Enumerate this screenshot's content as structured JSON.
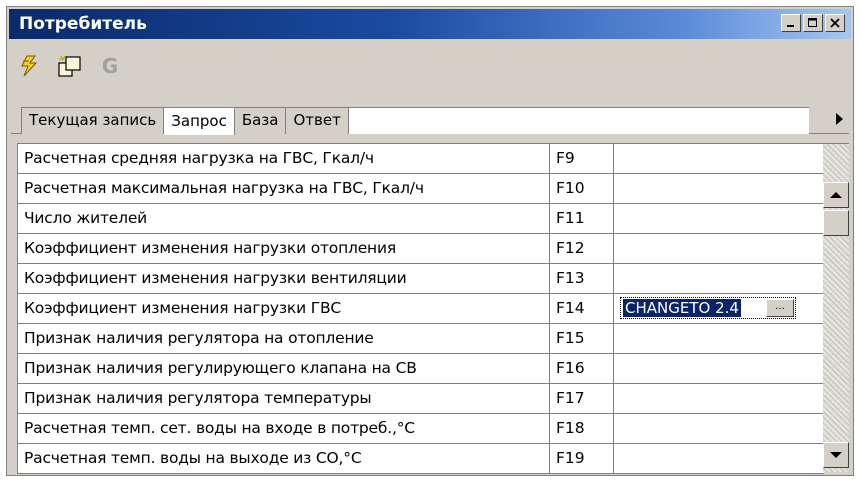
{
  "window": {
    "title": "Потребитель",
    "controls": [
      "minimize",
      "maximize",
      "close"
    ]
  },
  "toolbar": {
    "icons": [
      "lightning-icon",
      "new-document-icon",
      "g-icon"
    ],
    "g_label": "G",
    "g_color": "#a0a0a0"
  },
  "tabs": [
    {
      "label": "Текущая запись",
      "active": false
    },
    {
      "label": "Запрос",
      "active": true
    },
    {
      "label": "База",
      "active": false
    },
    {
      "label": "Ответ",
      "active": false
    }
  ],
  "rows": [
    {
      "name": "Расчетная средняя нагрузка на ГВС, Гкал/ч",
      "code": "F9",
      "value": ""
    },
    {
      "name": "Расчетная максимальная нагрузка на ГВС, Гкал/ч",
      "code": "F10",
      "value": ""
    },
    {
      "name": "Число жителей",
      "code": "F11",
      "value": ""
    },
    {
      "name": "Коэффициент изменения нагрузки отопления",
      "code": "F12",
      "value": ""
    },
    {
      "name": "Коэффициент изменения нагрузки вентиляции",
      "code": "F13",
      "value": ""
    },
    {
      "name": "Коэффициент изменения нагрузки ГВС",
      "code": "F14",
      "value": "CHANGETO 2.4",
      "editing": true
    },
    {
      "name": "Признак наличия регулятора на отопление",
      "code": "F15",
      "value": ""
    },
    {
      "name": "Признак наличия регулирующего клапана на СВ",
      "code": "F16",
      "value": ""
    },
    {
      "name": "Признак наличия регулятора температуры",
      "code": "F17",
      "value": ""
    },
    {
      "name": "Расчетная темп. сет. воды на входе в потреб.,°С",
      "code": "F18",
      "value": ""
    },
    {
      "name": "Расчетная темп. воды на выходе из СО,°С",
      "code": "F19",
      "value": ""
    }
  ],
  "editor": {
    "ellipsis_label": "..."
  },
  "colors": {
    "title_bar_start": "#0a2a6a",
    "title_bar_end": "#a6c8f0",
    "selection": "#0a246a",
    "lightning": "#f0d020"
  }
}
